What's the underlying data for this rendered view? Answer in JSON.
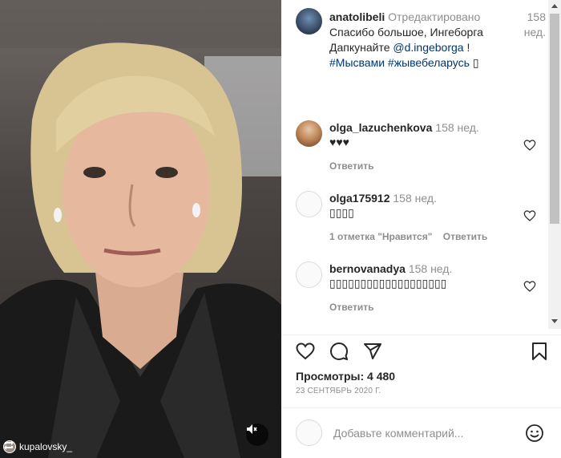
{
  "media": {
    "repost_username": "kupalovsky_",
    "mute_icon": "mute-icon",
    "repost_icon": "repost-icon"
  },
  "caption": {
    "username": "anatolibeli",
    "edited_label": "Отредактировано",
    "time": "158 нед.",
    "text_line1": "Спасибо большое, Ингеборга",
    "text_line2_prefix": "Дапкунайте ",
    "mention": "@d.ingeborga",
    "text_line2_suffix": " !",
    "hashtags": "#Мысвами #жывебеларусь",
    "emoji_box": "▯"
  },
  "comments": [
    {
      "username": "olga_lazuchenkova",
      "time": "158 нед.",
      "text": "♥♥♥",
      "reply_label": "Ответить",
      "likes_label": ""
    },
    {
      "username": "olga175912",
      "time": "158 нед.",
      "text": "▯▯▯▯",
      "reply_label": "Ответить",
      "likes_label": "1 отметка \"Нравится\""
    },
    {
      "username": "bernovanadya",
      "time": "158 нед.",
      "text": "▯▯▯▯▯▯▯▯▯▯▯▯▯▯▯▯▯▯▯",
      "reply_label": "Ответить",
      "likes_label": ""
    }
  ],
  "stats": {
    "views": "Просмотры: 4 480",
    "date": "23 СЕНТЯБРЬ 2020 Г."
  },
  "add_comment": {
    "placeholder": "Добавьте комментарий..."
  },
  "colors": {
    "link": "#00376b",
    "secondary": "#8e8e8e",
    "primary": "#262626"
  }
}
